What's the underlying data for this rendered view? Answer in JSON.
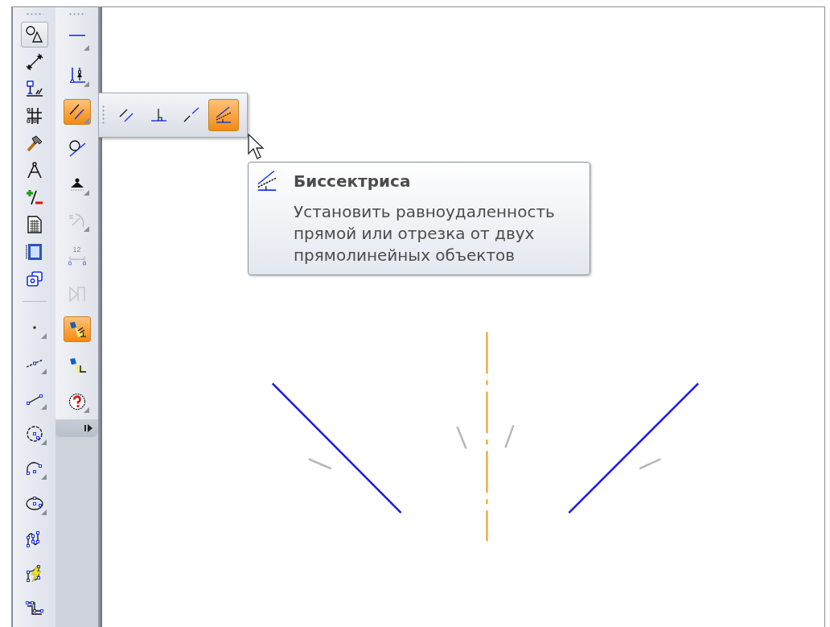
{
  "left_toolbar": {
    "buttons": [
      {
        "selected": true,
        "flyout": false
      },
      {
        "selected": false,
        "flyout": false
      },
      {
        "selected": false,
        "flyout": false
      },
      {
        "selected": false,
        "flyout": false
      },
      {
        "selected": false,
        "flyout": false
      },
      {
        "selected": false,
        "flyout": false
      },
      {
        "selected": false,
        "flyout": false
      },
      {
        "selected": false,
        "flyout": false
      },
      {
        "selected": false,
        "flyout": false
      },
      {
        "selected": false,
        "flyout": false
      }
    ],
    "lower_buttons": [
      {
        "selected": false,
        "flyout": true
      },
      {
        "selected": false,
        "flyout": true
      },
      {
        "selected": false,
        "flyout": true
      },
      {
        "selected": false,
        "flyout": true
      },
      {
        "selected": false,
        "flyout": true
      },
      {
        "selected": false,
        "flyout": true
      },
      {
        "selected": false,
        "flyout": false
      },
      {
        "selected": false,
        "flyout": false
      },
      {
        "selected": false,
        "flyout": false
      }
    ]
  },
  "constraints_toolbar": {
    "buttons": [
      {
        "selected": false,
        "flyout": true,
        "disabled": false
      },
      {
        "selected": false,
        "flyout": true,
        "disabled": false
      },
      {
        "selected": true,
        "flyout": true,
        "disabled": false
      },
      {
        "selected": false,
        "flyout": false,
        "disabled": false
      },
      {
        "selected": false,
        "flyout": true,
        "disabled": false
      },
      {
        "selected": false,
        "flyout": true,
        "disabled": true
      },
      {
        "selected": false,
        "flyout": false,
        "disabled": true,
        "label": "12"
      },
      {
        "selected": false,
        "flyout": false,
        "disabled": true
      },
      {
        "selected": true,
        "flyout": false,
        "disabled": false
      },
      {
        "selected": false,
        "flyout": false,
        "disabled": false
      },
      {
        "selected": false,
        "flyout": true,
        "disabled": false
      }
    ]
  },
  "flyout_toolbar": {
    "buttons": [
      {
        "selected": false
      },
      {
        "selected": false
      },
      {
        "selected": false
      },
      {
        "selected": true
      }
    ]
  },
  "tooltip": {
    "title": "Биссектриса",
    "description": "Установить равноудаленность прямой или отрезка от двух прямолинейных объектов"
  }
}
